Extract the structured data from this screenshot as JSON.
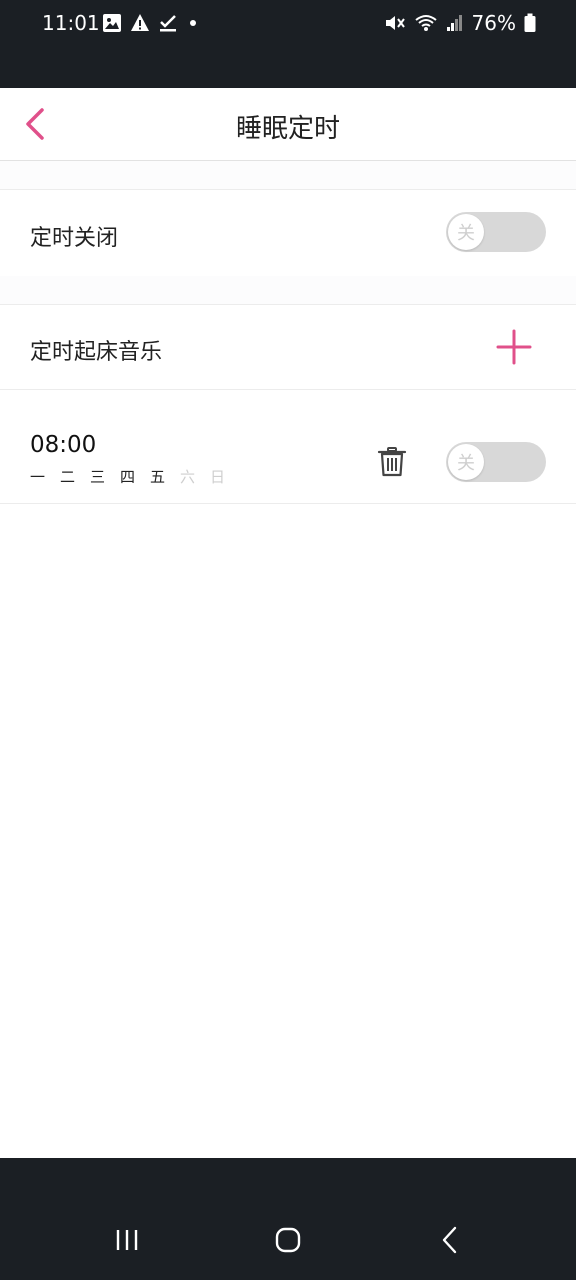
{
  "status_bar": {
    "time": "11:01",
    "battery_percent": "76%",
    "left_icons": [
      "image-icon",
      "warning-icon",
      "check-icon",
      "dot-icon"
    ],
    "right_icons": [
      "mute-icon",
      "wifi-icon",
      "signal-icon",
      "battery-icon"
    ]
  },
  "header": {
    "title": "睡眠定时",
    "back_icon": "chevron-left-icon"
  },
  "timer_off": {
    "label": "定时关闭",
    "toggle_text": "关",
    "enabled": false
  },
  "wake_music": {
    "label": "定时起床音乐",
    "add_icon": "plus-icon"
  },
  "alarm": {
    "time": "08:00",
    "days": [
      {
        "label": "一",
        "active": true
      },
      {
        "label": "二",
        "active": true
      },
      {
        "label": "三",
        "active": true
      },
      {
        "label": "四",
        "active": true
      },
      {
        "label": "五",
        "active": true
      },
      {
        "label": "六",
        "active": false
      },
      {
        "label": "日",
        "active": false
      }
    ],
    "delete_icon": "trash-icon",
    "toggle_text": "关",
    "enabled": false
  },
  "nav_bar": {
    "buttons": [
      "recent-apps-icon",
      "home-icon",
      "back-icon"
    ]
  },
  "colors": {
    "accent": "#e0508a",
    "status_bar_bg": "#1b1f24",
    "toggle_off_bg": "#d8d8d8"
  }
}
